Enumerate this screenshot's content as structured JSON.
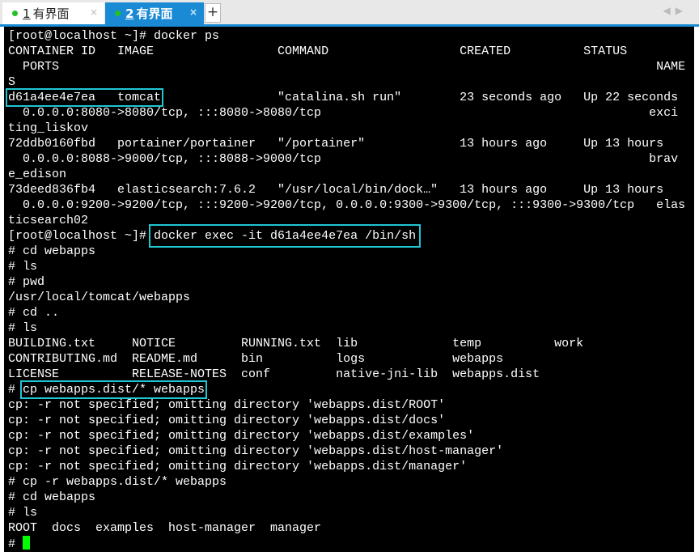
{
  "tabs": [
    {
      "number": "1",
      "label": "有界面",
      "active": false,
      "status_color": "#22c022"
    },
    {
      "number": "2",
      "label": "有界面",
      "active": true,
      "status_color": "#22c022"
    }
  ],
  "tab_close_glyph": "×",
  "add_tab_glyph": "+",
  "nav_arrows": "◀▶",
  "colors": {
    "accent": "#1a8ad4",
    "highlight_box": "#20c6d2",
    "cursor": "#00ff00"
  },
  "terminal": {
    "lines": [
      {
        "text": "[root@localhost ~]# docker ps"
      },
      {
        "text": "CONTAINER ID   IMAGE                 COMMAND                  CREATED          STATUS"
      },
      {
        "text": "  PORTS                                                                                  NAME"
      },
      {
        "text": "S"
      },
      {
        "pre": "",
        "box": "d61a4ee4e7ea   tomcat",
        "post": "                \"catalina.sh run\"        23 seconds ago   Up 22 seconds"
      },
      {
        "text": "  0.0.0.0:8080->8080/tcp, :::8080->8080/tcp                                             exci"
      },
      {
        "text": "ting_liskov"
      },
      {
        "text": "72ddb0160fbd   portainer/portainer   \"/portainer\"             13 hours ago     Up 13 hours"
      },
      {
        "text": "  0.0.0.0:8088->9000/tcp, :::8088->9000/tcp                                             brav"
      },
      {
        "text": "e_edison"
      },
      {
        "text": "73deed836fb4   elasticsearch:7.6.2   \"/usr/local/bin/dock…\"   13 hours ago     Up 13 hours"
      },
      {
        "text": "  0.0.0.0:9200->9200/tcp, :::9200->9200/tcp, 0.0.0.0:9300->9300/tcp, :::9300->9300/tcp   elas"
      },
      {
        "text": "ticsearch02"
      },
      {
        "pre": "[root@localhost ~]# ",
        "box": "docker exec -it d61a4ee4e7ea /bin/sh",
        "post": "",
        "big": true
      },
      {
        "text": "# cd webapps"
      },
      {
        "text": "# ls"
      },
      {
        "text": "# pwd"
      },
      {
        "text": "/usr/local/tomcat/webapps"
      },
      {
        "text": "# cd .."
      },
      {
        "text": "# ls"
      },
      {
        "text": "BUILDING.txt     NOTICE         RUNNING.txt  lib             temp          work"
      },
      {
        "text": "CONTRIBUTING.md  README.md      bin          logs            webapps"
      },
      {
        "text": "LICENSE          RELEASE-NOTES  conf         native-jni-lib  webapps.dist"
      },
      {
        "pre": "# ",
        "box": "cp webapps.dist/* webapps",
        "post": ""
      },
      {
        "text": "cp: -r not specified; omitting directory 'webapps.dist/ROOT'"
      },
      {
        "text": "cp: -r not specified; omitting directory 'webapps.dist/docs'"
      },
      {
        "text": "cp: -r not specified; omitting directory 'webapps.dist/examples'"
      },
      {
        "text": "cp: -r not specified; omitting directory 'webapps.dist/host-manager'"
      },
      {
        "text": "cp: -r not specified; omitting directory 'webapps.dist/manager'"
      },
      {
        "text": "# cp -r webapps.dist/* webapps"
      },
      {
        "text": "# cd webapps"
      },
      {
        "text": "# ls"
      },
      {
        "text": "ROOT  docs  examples  host-manager  manager"
      },
      {
        "text": "# ",
        "cursor": true
      }
    ]
  }
}
